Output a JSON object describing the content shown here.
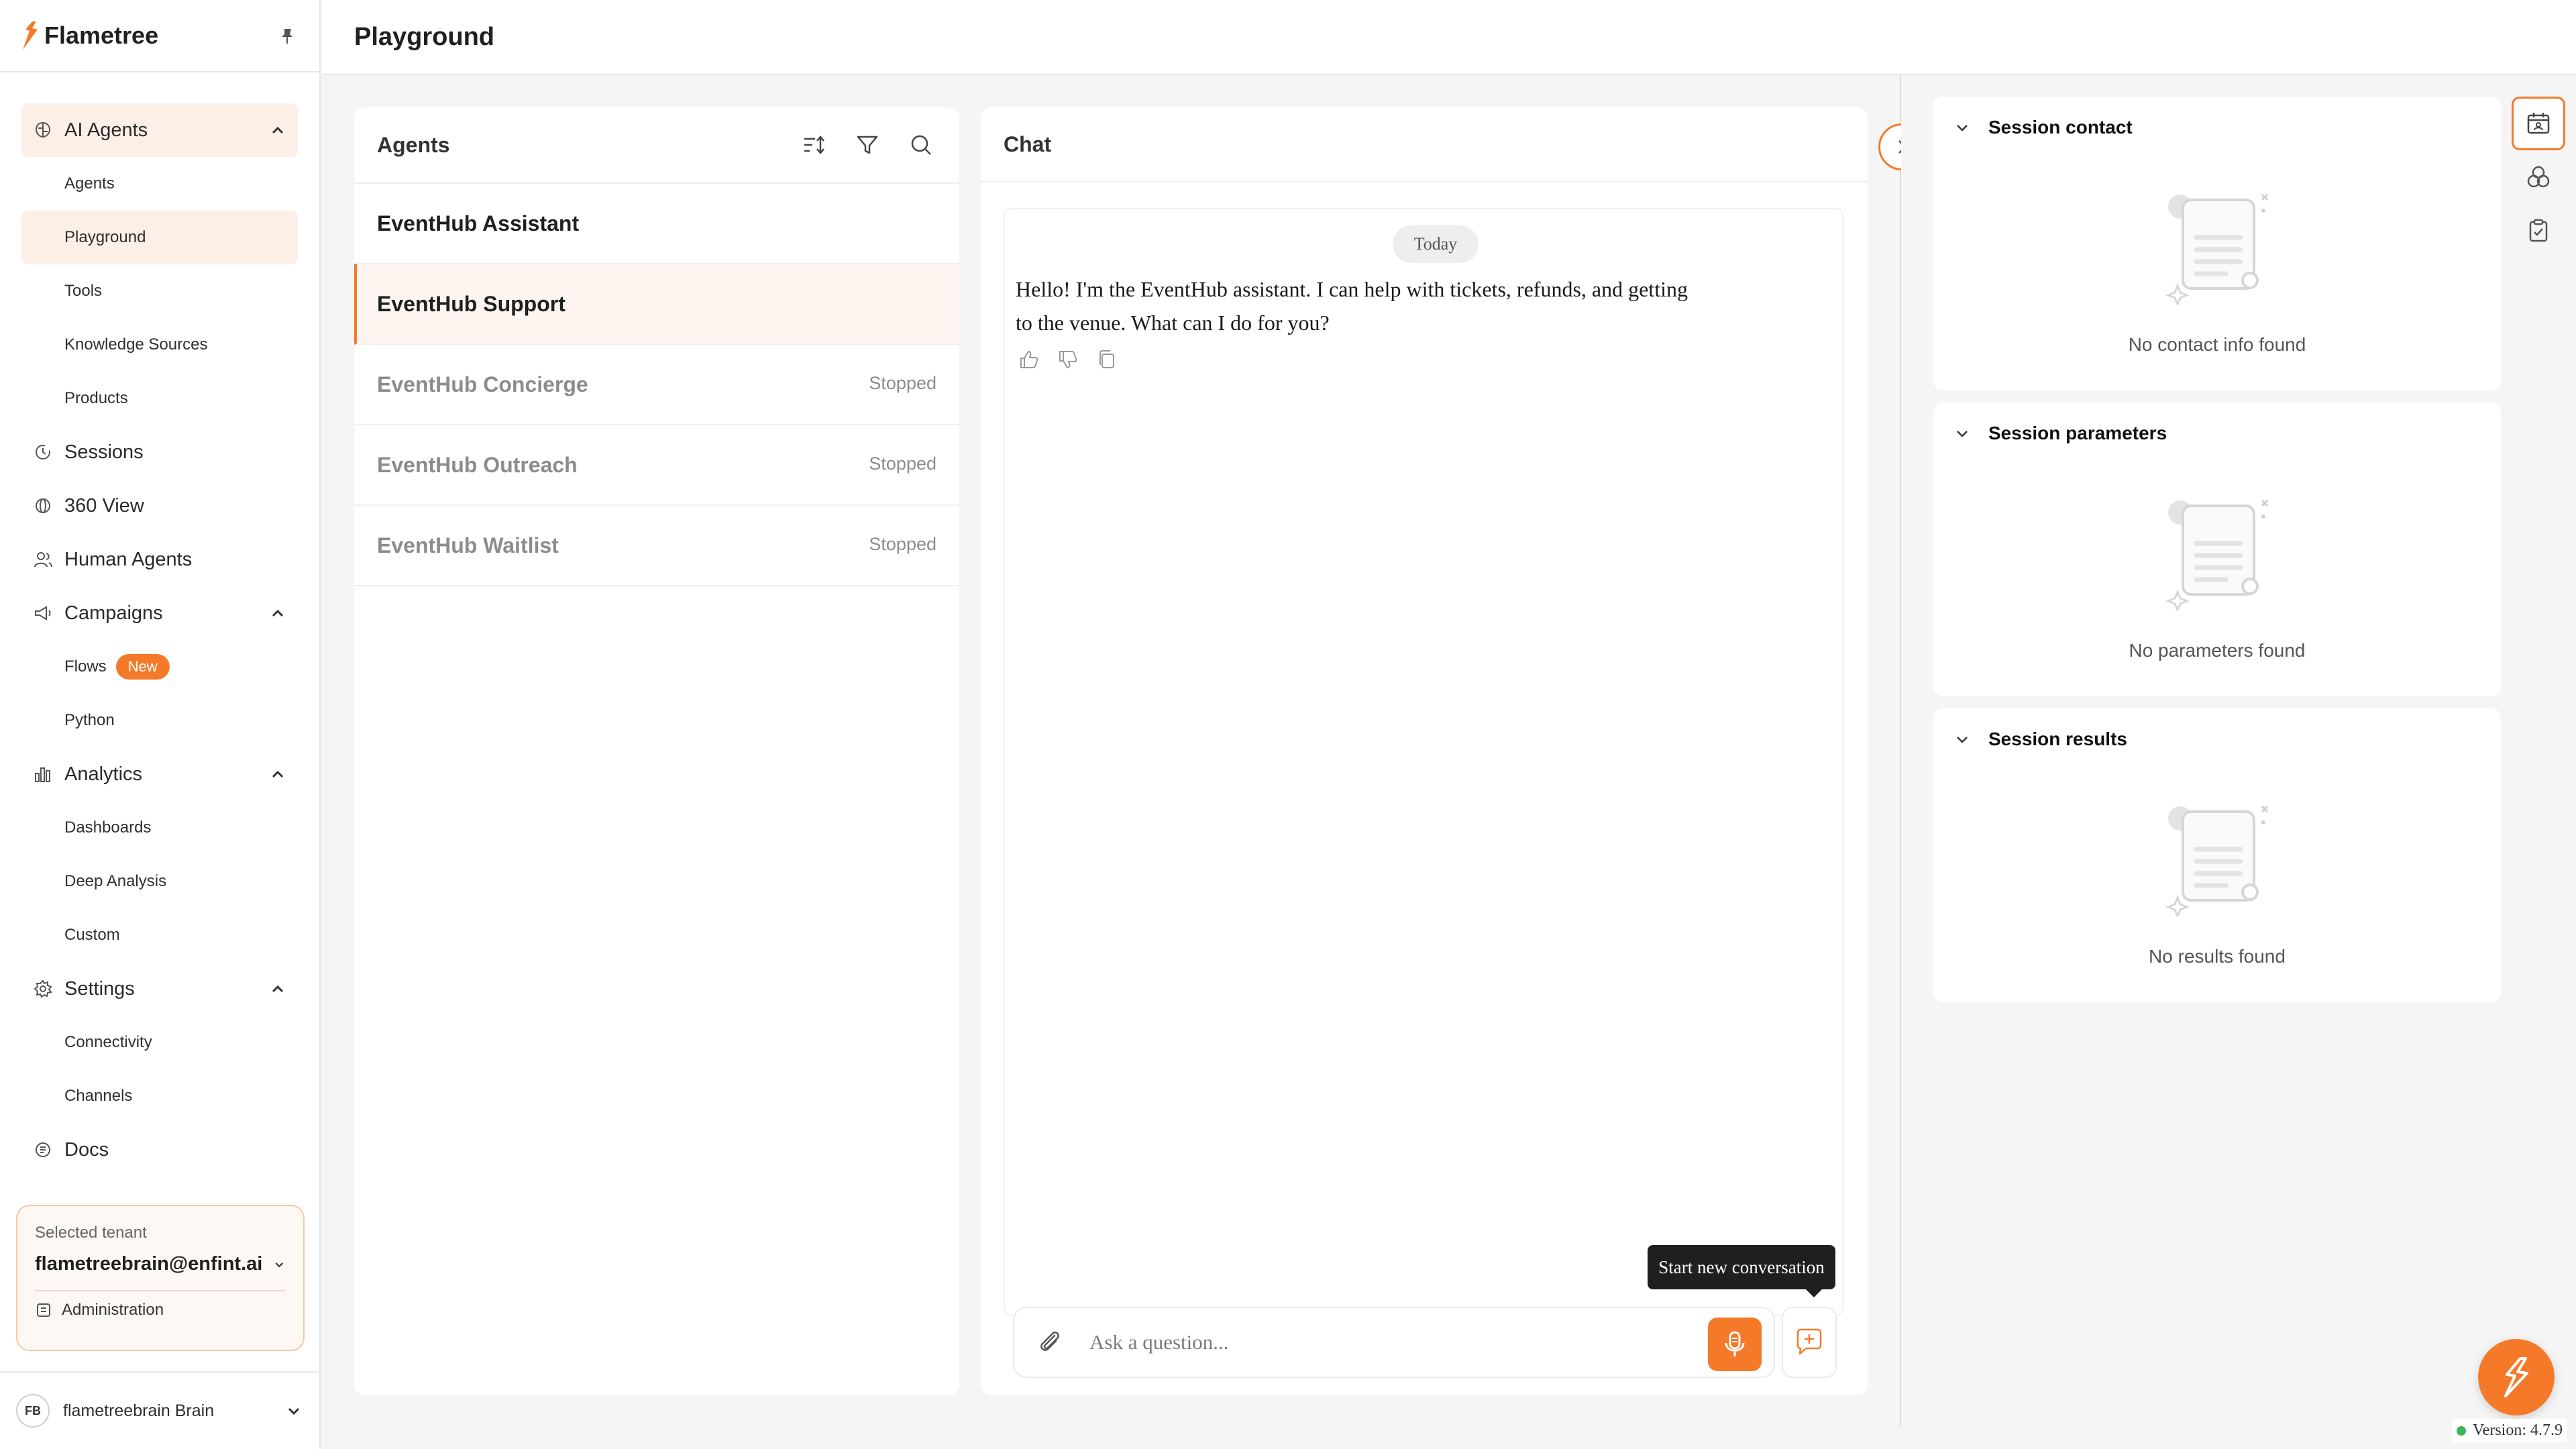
{
  "app": {
    "name": "Flametree",
    "page_title": "Playground",
    "brand_color": "#f47a2a"
  },
  "sidebar": {
    "items": [
      {
        "label": "AI Agents",
        "icon": "brain-icon",
        "expanded": true,
        "children": [
          "Agents",
          "Playground",
          "Tools",
          "Knowledge Sources",
          "Products"
        ]
      },
      {
        "label": "Sessions",
        "icon": "history-icon"
      },
      {
        "label": "360 View",
        "icon": "globe-icon"
      },
      {
        "label": "Human Agents",
        "icon": "users-icon"
      },
      {
        "label": "Campaigns",
        "icon": "megaphone-icon",
        "expanded": true,
        "children": [
          "Flows",
          "Python"
        ],
        "flows_badge": "New"
      },
      {
        "label": "Analytics",
        "icon": "bar-chart-icon",
        "expanded": true,
        "children": [
          "Dashboards",
          "Deep Analysis",
          "Custom"
        ]
      },
      {
        "label": "Settings",
        "icon": "gear-icon",
        "expanded": true,
        "children": [
          "Connectivity",
          "Channels"
        ]
      },
      {
        "label": "Docs",
        "icon": "docs-icon"
      }
    ],
    "active_child": "Playground",
    "tenant": {
      "label": "Selected tenant",
      "value": "flametreebrain@enfint.ai",
      "admin_label": "Administration"
    },
    "user": {
      "initials": "FB",
      "name": "flametreebrain Brain"
    }
  },
  "agents_panel": {
    "title": "Agents",
    "agents": [
      {
        "name": "EventHub Assistant",
        "status": ""
      },
      {
        "name": "EventHub Support",
        "status": "",
        "selected": true
      },
      {
        "name": "EventHub Concierge",
        "status": "Stopped"
      },
      {
        "name": "EventHub Outreach",
        "status": "Stopped"
      },
      {
        "name": "EventHub Waitlist",
        "status": "Stopped"
      }
    ]
  },
  "chat": {
    "title": "Chat",
    "date_pill": "Today",
    "message": "Hello! I'm the EventHub assistant. I can help with tickets, refunds, and getting to the venue. What can I do for you?",
    "input_value": "",
    "input_placeholder": "Ask a question...",
    "tooltip": "Start new conversation"
  },
  "session": {
    "cards": [
      {
        "title": "Session contact",
        "empty": "No contact info found"
      },
      {
        "title": "Session parameters",
        "empty": "No parameters found"
      },
      {
        "title": "Session results",
        "empty": "No results found"
      }
    ]
  },
  "version": "Version: 4.7.9"
}
